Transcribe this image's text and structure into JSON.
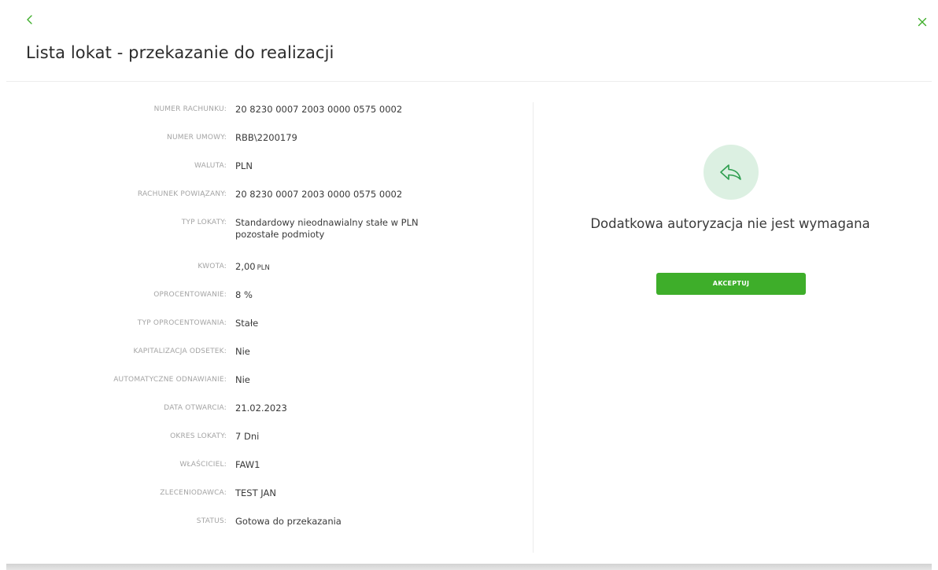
{
  "header": {
    "title": "Lista lokat - przekazanie do realizacji"
  },
  "details": [
    {
      "label": "NUMER RACHUNKU:",
      "value": "20 8230 0007 2003 0000 0575 0002"
    },
    {
      "label": "NUMER UMOWY:",
      "value": "RBB\\2200179"
    },
    {
      "label": "WALUTA:",
      "value": "PLN"
    },
    {
      "label": "RACHUNEK POWIĄZANY:",
      "value": "20 8230 0007 2003 0000 0575 0002"
    },
    {
      "label": "TYP LOKATY:",
      "value": "Standardowy nieodnawialny stałe w PLN",
      "value2": "pozostałe podmioty"
    },
    {
      "label": "KWOTA:",
      "value": "2,00",
      "unit": "PLN"
    },
    {
      "label": "OPROCENTOWANIE:",
      "value": "8 %"
    },
    {
      "label": "TYP OPROCENTOWANIA:",
      "value": "Stałe"
    },
    {
      "label": "KAPITALIZACJA ODSETEK:",
      "value": "Nie"
    },
    {
      "label": "AUTOMATYCZNE ODNAWIANIE:",
      "value": "Nie"
    },
    {
      "label": "DATA OTWARCIA:",
      "value": "21.02.2023"
    },
    {
      "label": "OKRES LOKATY:",
      "value": "7 Dni"
    },
    {
      "label": "WŁAŚCICIEL:",
      "value": "FAW1"
    },
    {
      "label": "ZLECENIODAWCA:",
      "value": "TEST JAN"
    },
    {
      "label": "STATUS:",
      "value": "Gotowa do przekazania"
    }
  ],
  "authorization": {
    "message": "Dodatkowa autoryzacja nie jest wymagana",
    "accept_label": "AKCEPTUJ"
  },
  "icons": {
    "back": "chevron-left-icon",
    "close": "close-icon",
    "authorization": "reply-arrow-icon"
  },
  "colors": {
    "accent": "#3eae2a",
    "icon_green": "#2e9e4f",
    "icon_bg": "#dcf0e2"
  }
}
